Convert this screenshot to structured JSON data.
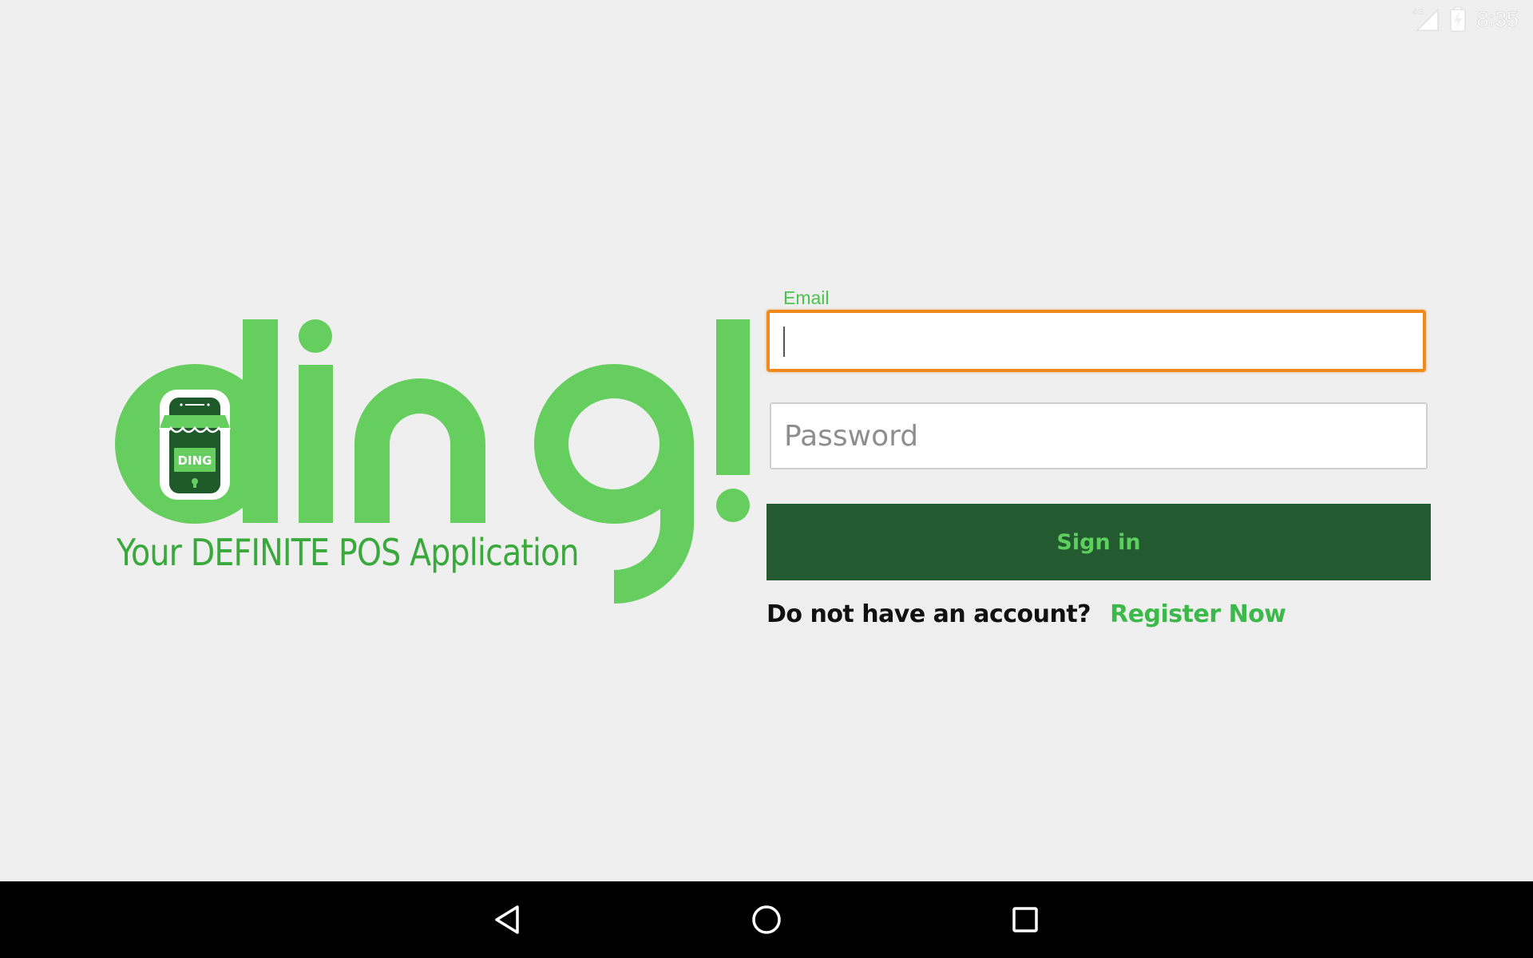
{
  "status_bar": {
    "network": "4G",
    "time": "8:35",
    "icons": [
      "signal-icon",
      "battery-charging-icon"
    ]
  },
  "logo": {
    "brand": "ding!",
    "phone_label": "DING",
    "tagline": "Your DEFINITE POS Application"
  },
  "login_form": {
    "email_label": "Email",
    "email_value": "",
    "password_placeholder": "Password",
    "password_value": "",
    "sign_in_label": "Sign in",
    "register_prompt": "Do not have an account?",
    "register_link": "Register Now"
  },
  "nav_bar": {
    "buttons": [
      "back-icon",
      "home-icon",
      "recents-icon"
    ]
  },
  "colors": {
    "background": "#efefef",
    "brand_green": "#66cd5f",
    "dark_green": "#245a30",
    "focus_orange": "#f08a1c",
    "link_green": "#3db84a"
  }
}
